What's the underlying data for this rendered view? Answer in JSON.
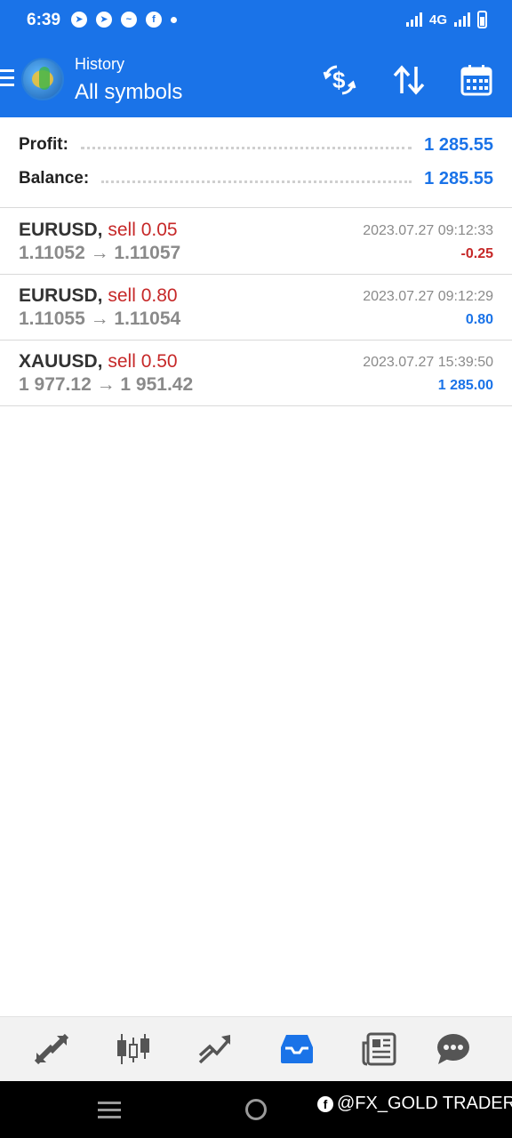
{
  "status": {
    "time": "6:39",
    "network": "4G"
  },
  "header": {
    "section": "History",
    "filter": "All symbols"
  },
  "summary": {
    "profit_label": "Profit:",
    "profit_value": "1 285.55",
    "balance_label": "Balance:",
    "balance_value": "1 285.55"
  },
  "deals": [
    {
      "symbol": "EURUSD,",
      "side": "sell 0.05",
      "prices": "1.11052 → 1.11057",
      "time": "2023.07.27 09:12:33",
      "profit": "-0.25"
    },
    {
      "symbol": "EURUSD,",
      "side": "sell 0.80",
      "prices": "1.11055 → 1.11054",
      "time": "2023.07.27 09:12:29",
      "profit": "0.80"
    },
    {
      "symbol": "XAUUSD,",
      "side": "sell 0.50",
      "prices": "1 977.12 → 1 951.42",
      "time": "2023.07.27 15:39:50",
      "profit": "1 285.00"
    }
  ],
  "watermark": "@FX_GOLD TRADER",
  "colors": {
    "primary": "#1a73e8",
    "loss": "#c62828",
    "muted": "#8a8a8a"
  },
  "icons": {
    "header": [
      "dollar-exchange-icon",
      "sort-icon",
      "calendar-icon"
    ],
    "bottom_nav": [
      "trade-icon",
      "quotes-chart-icon",
      "chart-icon",
      "history-inbox-icon",
      "news-icon",
      "chat-icon"
    ]
  }
}
